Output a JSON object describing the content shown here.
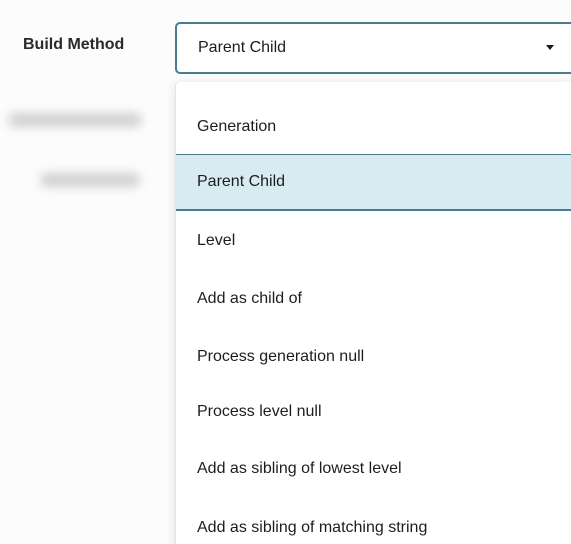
{
  "form": {
    "label": "Build Method",
    "selected_value": "Parent Child"
  },
  "dropdown": {
    "options": [
      {
        "label": "Generation",
        "selected": false
      },
      {
        "label": "Parent Child",
        "selected": true
      },
      {
        "label": "Level",
        "selected": false
      },
      {
        "label": "Add as child of",
        "selected": false
      },
      {
        "label": "Process generation null",
        "selected": false
      },
      {
        "label": "Process level null",
        "selected": false
      },
      {
        "label": "Add as sibling of lowest level",
        "selected": false
      },
      {
        "label": "Add as sibling of matching string",
        "selected": false
      }
    ]
  },
  "colors": {
    "focus_border": "#4a7c90",
    "selected_option_bg": "#d8eaf2"
  },
  "icons": {
    "select_caret": "caret-down-icon"
  }
}
